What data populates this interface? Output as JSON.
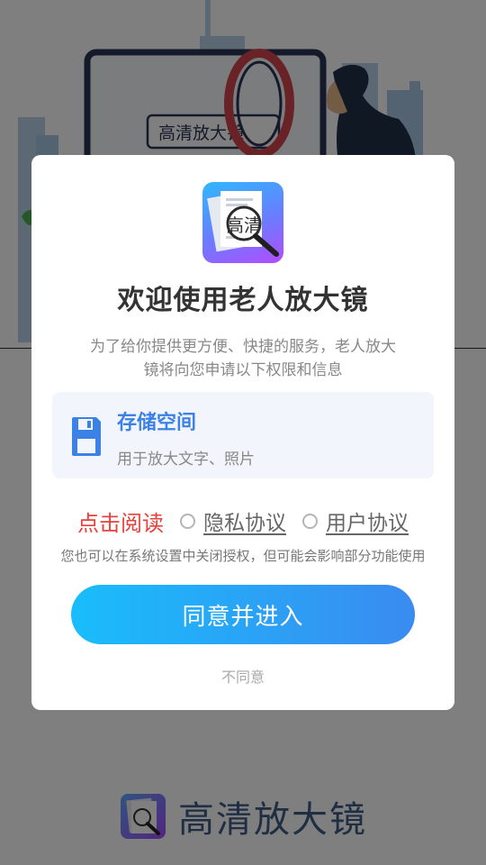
{
  "background": {
    "sign_text": "高清放大镜",
    "brand_title": "高清放大镜"
  },
  "dialog": {
    "app_icon": "magnifier-document-icon",
    "app_icon_text": "高清",
    "title": "欢迎使用老人放大镜",
    "subtitle": "为了给你提供更方便、快捷的服务，老人放大镜将向您申请以下权限和信息",
    "permission": {
      "icon": "floppy-disk-icon",
      "title": "存储空间",
      "description": "用于放大文字、照片"
    },
    "read_label": "点击阅读",
    "privacy_label": "隐私协议",
    "user_agreement_label": "用户协议",
    "note": "您也可以在系统设置中关闭授权，但可能会影响部分功能使用",
    "agree_button": "同意并进入",
    "disagree_button": "不同意"
  },
  "colors": {
    "accent_blue": "#3c82e6",
    "button_gradient_start": "#19bdfb",
    "button_gradient_end": "#3a8bf0",
    "read_red": "#e8403a",
    "overlay": "rgba(0,0,0,0.5)"
  }
}
